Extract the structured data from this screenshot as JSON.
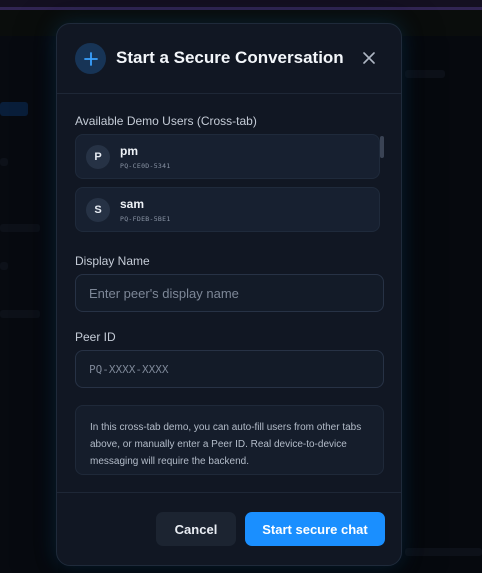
{
  "modal": {
    "title": "Start a Secure Conversation",
    "header_icon": "plus-icon",
    "close_icon": "close-icon"
  },
  "demo_users": {
    "label": "Available Demo Users (Cross-tab)",
    "items": [
      {
        "initial": "P",
        "name": "pm",
        "peer_id": "PQ-CE0D-5341"
      },
      {
        "initial": "S",
        "name": "sam",
        "peer_id": "PQ-FDEB-5BE1"
      }
    ]
  },
  "display_name": {
    "label": "Display Name",
    "value": "",
    "placeholder": "Enter peer's display name"
  },
  "peer_id": {
    "label": "Peer ID",
    "value": "",
    "placeholder": "PQ-XXXX-XXXX"
  },
  "info_text": "In this cross-tab demo, you can auto-fill users from other tabs above, or manually enter a Peer ID. Real device-to-device messaging will require the backend.",
  "footer": {
    "cancel_label": "Cancel",
    "submit_label": "Start secure chat"
  },
  "colors": {
    "accent": "#1a8fff",
    "modal_bg": "#111723",
    "card_bg": "#172030"
  }
}
